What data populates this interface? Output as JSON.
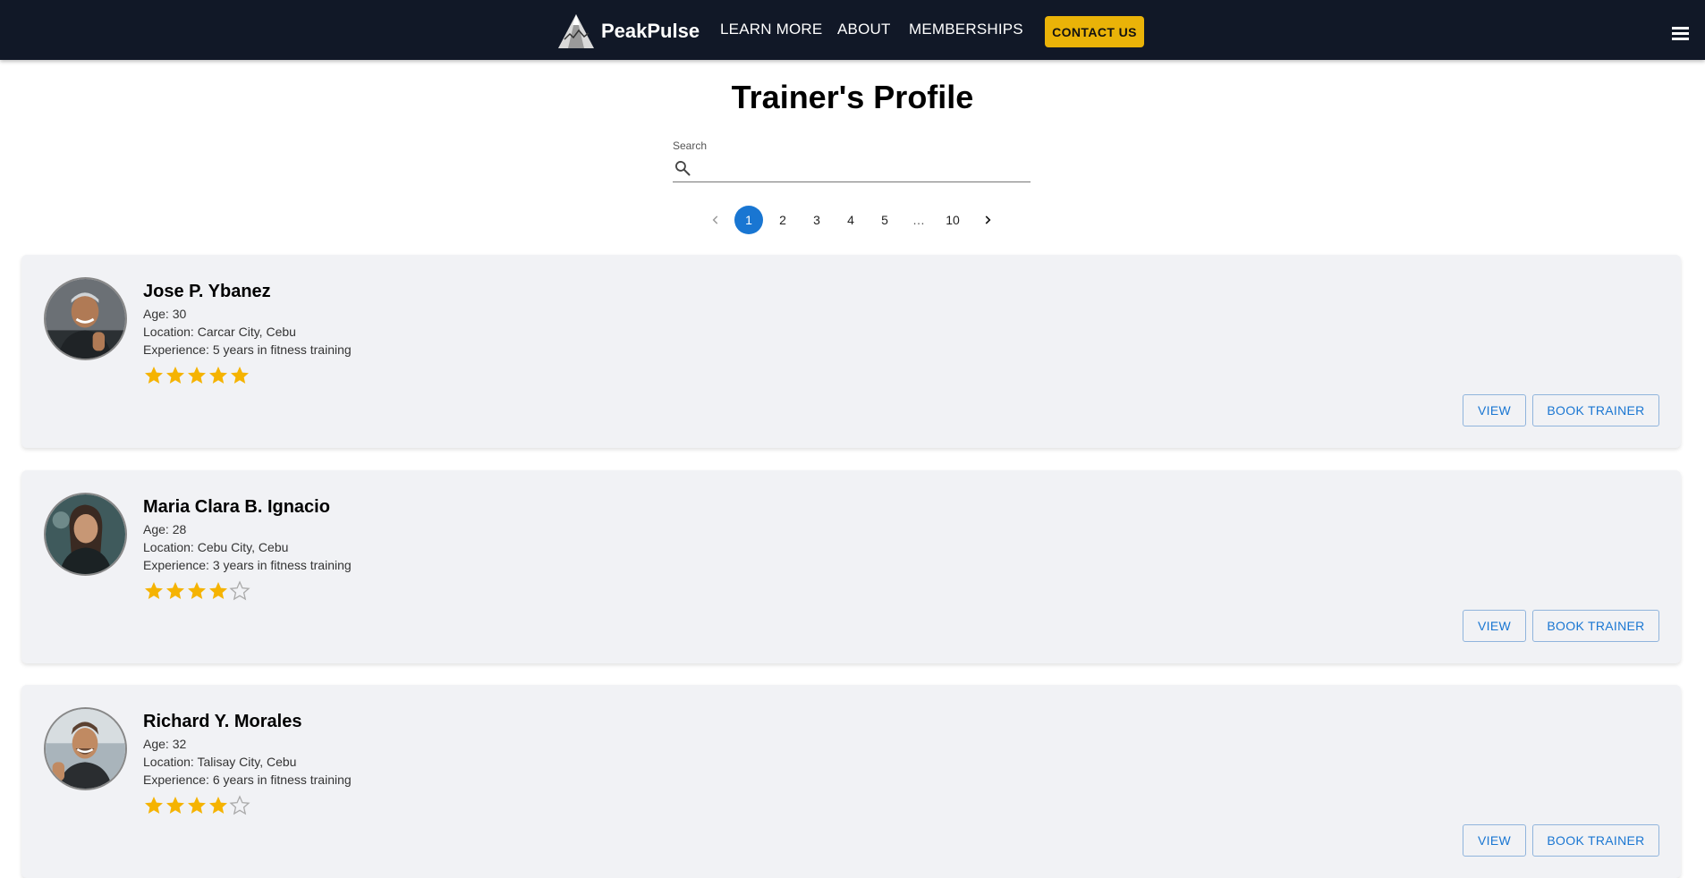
{
  "navbar": {
    "brand": "PeakPulse",
    "links": [
      "LEARN MORE",
      "ABOUT",
      "MEMBERSHIPS"
    ],
    "contact": "CONTACT US",
    "menu_icon": "hamburger-menu-icon"
  },
  "page": {
    "title": "Trainer's Profile"
  },
  "search": {
    "label": "Search",
    "placeholder": "",
    "value": "",
    "icon": "search-icon"
  },
  "pagination": {
    "current": "1",
    "pages": [
      "1",
      "2",
      "3",
      "4",
      "5",
      "…",
      "10"
    ],
    "prev_icon": "chevron-left-icon",
    "next_icon": "chevron-right-icon"
  },
  "trainers": [
    {
      "name": "Jose P. Ybanez",
      "age": "Age: 30",
      "location": "Location: Carcar City, Cebu",
      "experience": "Experience: 5 years in fitness training",
      "rating": 5,
      "view_label": "VIEW",
      "book_label": "BOOK TRAINER"
    },
    {
      "name": "Maria Clara B. Ignacio",
      "age": "Age: 28",
      "location": "Location: Cebu City, Cebu",
      "experience": "Experience: 3 years in fitness training",
      "rating": 4,
      "view_label": "VIEW",
      "book_label": "BOOK TRAINER"
    },
    {
      "name": "Richard Y. Morales",
      "age": "Age: 32",
      "location": "Location: Talisay City, Cebu",
      "experience": "Experience: 6 years in fitness training",
      "rating": 4,
      "view_label": "VIEW",
      "book_label": "BOOK TRAINER"
    }
  ],
  "colors": {
    "nav_bg": "#111827",
    "accent": "#eab308",
    "primary": "#1976d2",
    "card_bg": "#f1f2f5",
    "star": "#f5b301"
  }
}
